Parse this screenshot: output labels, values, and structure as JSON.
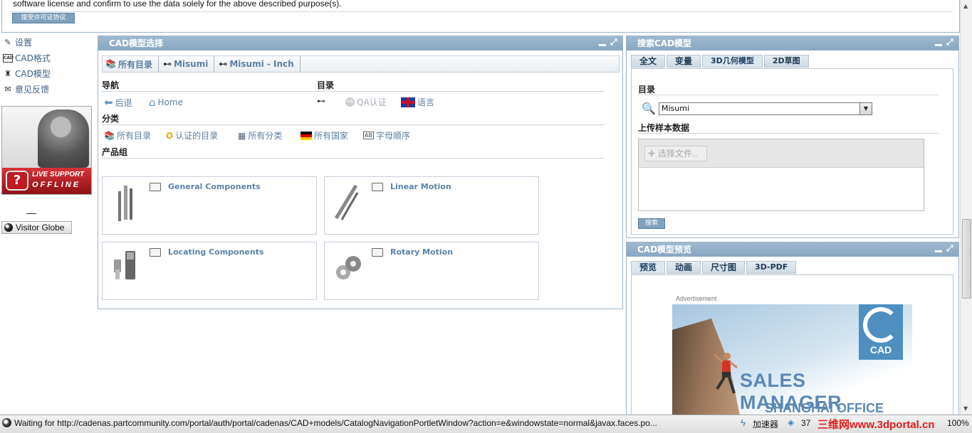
{
  "license": {
    "text": "software license and confirm to use the data solely for the above described purpose(s).",
    "accept_button": "接受许可证协议"
  },
  "left_menu": {
    "items": [
      {
        "label": "设置",
        "icon": "pencil-icon"
      },
      {
        "label": "CAD格式",
        "icon": "cad-icon"
      },
      {
        "label": "CAD模型",
        "icon": "model-icon"
      },
      {
        "label": "意见反馈",
        "icon": "mail-icon"
      }
    ],
    "live_support": {
      "line1": "LIVE SUPPORT",
      "line2": "OFFLINE",
      "q": "?"
    },
    "visitor_globe": "Visitor Globe"
  },
  "cad_panel": {
    "title": "CAD模型选择",
    "breadcrumb": [
      "所有目录",
      "Misumi",
      "Misumi - Inch"
    ],
    "nav": {
      "heading": "导航",
      "back": "后退",
      "home": "Home"
    },
    "catalog": {
      "heading": "目录",
      "qa": "QA认证",
      "language": "语言"
    },
    "category": {
      "heading": "分类",
      "items": [
        "所有目录",
        "认证的目录",
        "所有分类",
        "所有国家",
        "字母顺序"
      ]
    },
    "product_group": {
      "heading": "产品组",
      "items": [
        "General Components",
        "Linear Motion",
        "Locating Components",
        "Rotary Motion"
      ]
    }
  },
  "search_panel": {
    "title": "搜索CAD模型",
    "tabs": [
      "全文",
      "变量",
      "3D几何模型",
      "2D草图"
    ],
    "active_tab": "3D几何模型",
    "catalog_label": "目录",
    "catalog_value": "Misumi",
    "upload_label": "上传样本数据",
    "choose_file": "选择文件..",
    "search_button": "搜索"
  },
  "preview_panel": {
    "title": "CAD模型预览",
    "tabs": [
      "预览",
      "动画",
      "尺寸图",
      "3D-PDF"
    ],
    "active_tab": "预览",
    "ad_label": "Advertisement",
    "ad_logo": "CAD",
    "ad_headline": "SALES MANAGER",
    "ad_subline": "SHANGHAI OFFICE"
  },
  "status_bar": {
    "text": "Waiting for http://cadenas.partcommunity.com/portal/auth/portal/cadenas/CAD+models/CatalogNavigationPortletWindow?action=e&windowstate=normal&javax.faces.po...",
    "accelerator": "加速器",
    "count": "37",
    "zoom": "100%",
    "watermark": "三维网www.3dportal.cn"
  }
}
